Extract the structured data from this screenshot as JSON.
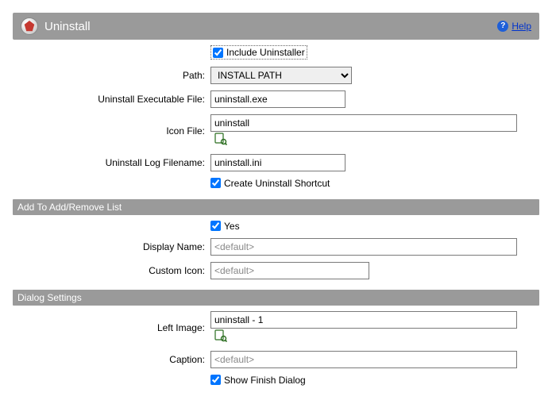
{
  "header": {
    "title": "Uninstall",
    "help_label": "Help"
  },
  "include_uninstaller": {
    "label": "Include Uninstaller",
    "checked": true
  },
  "path": {
    "label": "Path:",
    "value": "INSTALL PATH"
  },
  "exe_file": {
    "label": "Uninstall Executable File:",
    "value": "uninstall.exe"
  },
  "icon_file": {
    "label": "Icon File:",
    "value": "uninstall"
  },
  "log_file": {
    "label": "Uninstall Log Filename:",
    "value": "uninstall.ini"
  },
  "create_shortcut": {
    "label": "Create Uninstall Shortcut",
    "checked": true
  },
  "sections": {
    "add_remove": "Add To Add/Remove List",
    "dialog_settings": "Dialog Settings"
  },
  "add_remove_yes": {
    "label": "Yes",
    "checked": true
  },
  "display_name": {
    "label": "Display Name:",
    "placeholder": "<default>"
  },
  "custom_icon": {
    "label": "Custom Icon:",
    "placeholder": "<default>"
  },
  "left_image": {
    "label": "Left Image:",
    "value": "uninstall - 1"
  },
  "caption": {
    "label": "Caption:",
    "placeholder": "<default>"
  },
  "show_finish": {
    "label": "Show Finish Dialog",
    "checked": true
  }
}
